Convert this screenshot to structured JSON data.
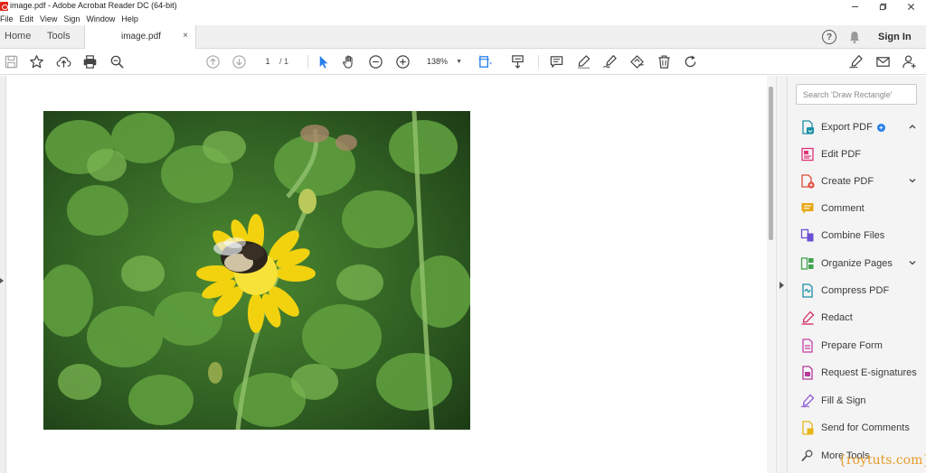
{
  "window": {
    "title": "image.pdf - Adobe Acrobat Reader DC (64-bit)"
  },
  "menubar": {
    "items": [
      {
        "label": "File"
      },
      {
        "label": "Edit"
      },
      {
        "label": "View"
      },
      {
        "label": "Sign"
      },
      {
        "label": "Window"
      },
      {
        "label": "Help"
      }
    ]
  },
  "tabs": {
    "home": "Home",
    "tools": "Tools",
    "document": "image.pdf",
    "close": "×"
  },
  "header": {
    "help": "?",
    "sign_in": "Sign In"
  },
  "toolbar": {
    "page_current": "1",
    "page_total": "/ 1",
    "zoom": "138%",
    "icons": [
      "save-icon",
      "bookmark-star-icon",
      "upload-cloud-icon",
      "print-icon",
      "search-zoom-icon",
      "prev-page-icon",
      "next-page-icon",
      "select-cursor-icon",
      "hand-icon",
      "zoom-out-icon",
      "zoom-in-icon",
      "fit-page-icon",
      "scroll-mode-icon",
      "comment-icon",
      "highlight-icon",
      "draw-icon",
      "stamp-icon",
      "delete-icon",
      "rotate-icon",
      "sign-icon",
      "email-icon",
      "share-user-icon"
    ]
  },
  "right_pane": {
    "search_placeholder": "Search 'Draw Rectangle'",
    "tools": [
      {
        "label": "Export PDF",
        "icon": "export-pdf-icon",
        "color": "#1a8fa6"
      },
      {
        "label": "Edit PDF",
        "icon": "edit-pdf-icon",
        "color": "#e0347a"
      },
      {
        "label": "Create PDF",
        "icon": "create-pdf-icon",
        "color": "#e04a3c"
      },
      {
        "label": "Comment",
        "icon": "comment-tool-icon",
        "color": "#e8a816"
      },
      {
        "label": "Combine Files",
        "icon": "combine-files-icon",
        "color": "#6b4fd6"
      },
      {
        "label": "Organize Pages",
        "icon": "organize-pages-icon",
        "color": "#3fa34d"
      },
      {
        "label": "Compress PDF",
        "icon": "compress-pdf-icon",
        "color": "#1a8fa6"
      },
      {
        "label": "Redact",
        "icon": "redact-icon",
        "color": "#d6336c"
      },
      {
        "label": "Prepare Form",
        "icon": "prepare-form-icon",
        "color": "#c43ea6"
      },
      {
        "label": "Request E-signatures",
        "icon": "request-esign-icon",
        "color": "#b33a9c"
      },
      {
        "label": "Fill & Sign",
        "icon": "fill-sign-icon",
        "color": "#8a5bd6"
      },
      {
        "label": "Send for Comments",
        "icon": "send-comments-icon",
        "color": "#e8b516"
      },
      {
        "label": "More Tools",
        "icon": "more-tools-icon",
        "color": "#555555"
      }
    ]
  },
  "watermark": "{roytuts.com}",
  "colors": {
    "acrobat_red": "#e0241a",
    "accent_blue": "#2680eb",
    "watermark_orange": "#e69b2a"
  }
}
